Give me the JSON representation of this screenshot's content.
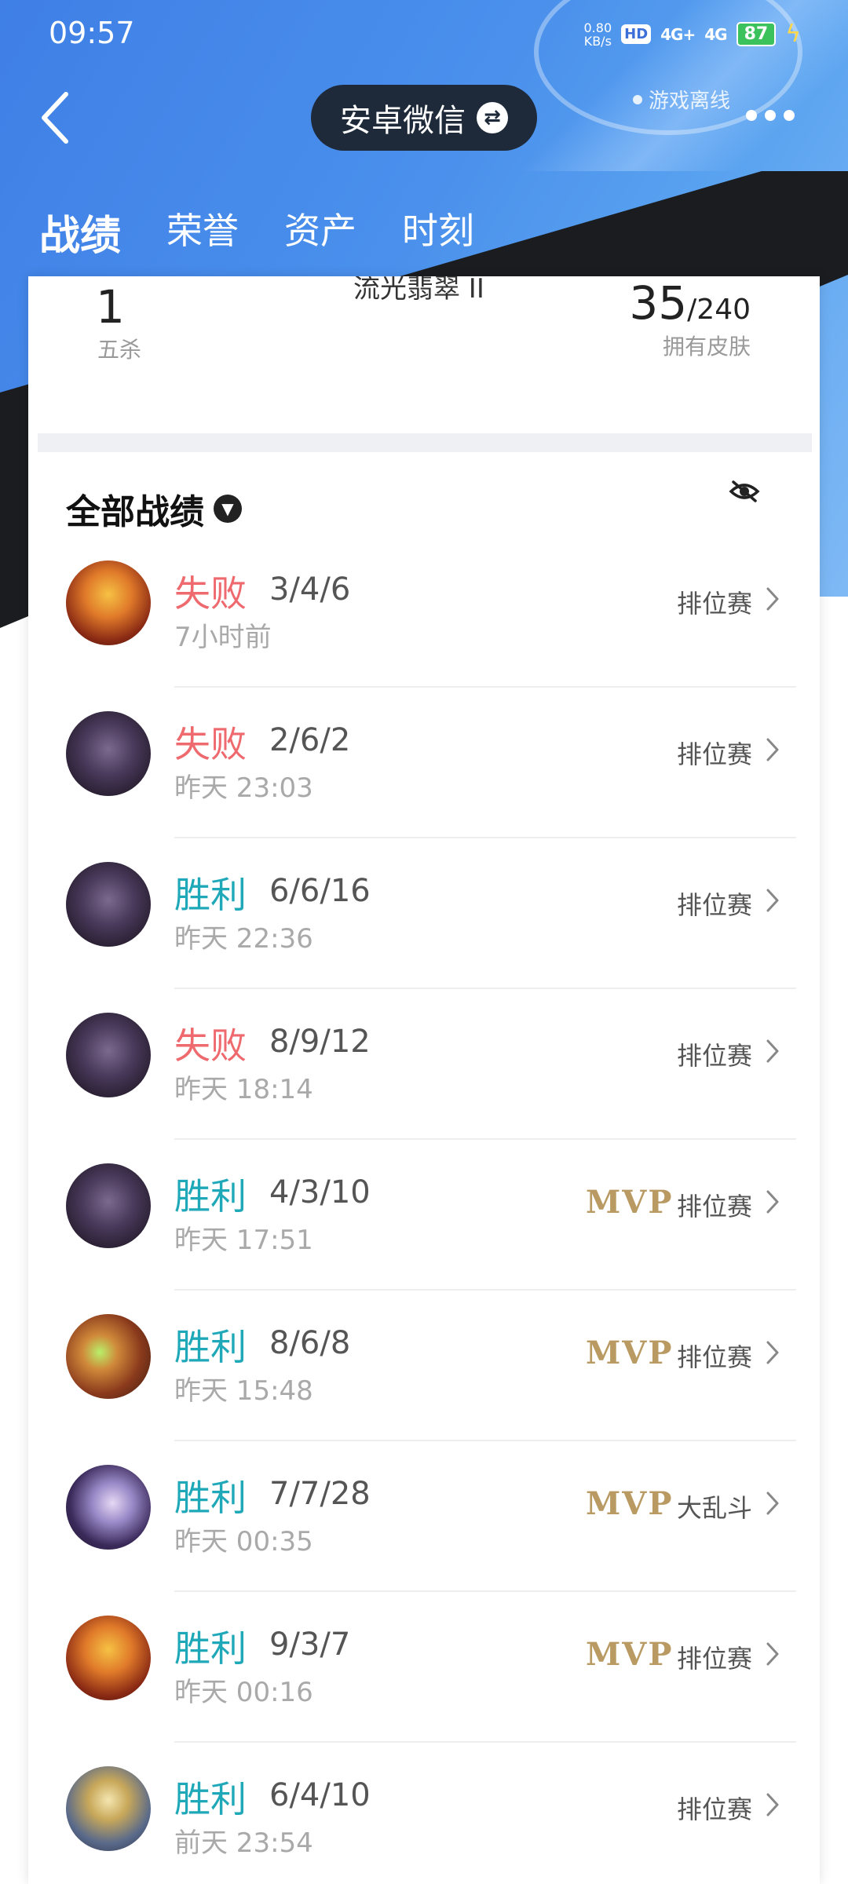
{
  "status_bar": {
    "time": "09:57",
    "net_speed_value": "0.80",
    "net_speed_unit": "KB/s",
    "hd": "HD",
    "signal_1": "4G+",
    "signal_2": "4G",
    "battery": "87"
  },
  "header": {
    "account_label": "安卓微信",
    "online_status": "游戏离线"
  },
  "tabs": [
    {
      "label": "战绩",
      "active": true
    },
    {
      "label": "荣誉",
      "active": false
    },
    {
      "label": "资产",
      "active": false
    },
    {
      "label": "时刻",
      "active": false
    }
  ],
  "stats": {
    "pentakill_count": "1",
    "pentakill_label": "五杀",
    "rank_title": "流光翡翠 II",
    "skins_owned": "35",
    "skins_total": "/240",
    "skins_label": "拥有皮肤"
  },
  "records": {
    "title": "全部战绩",
    "items": [
      {
        "result": "失败",
        "type": "loss",
        "kda": "3/4/6",
        "time": "7小时前",
        "mvp": "",
        "mode": "排位赛",
        "avatar": "fire"
      },
      {
        "result": "失败",
        "type": "loss",
        "kda": "2/6/2",
        "time": "昨天 23:03",
        "mvp": "",
        "mode": "排位赛",
        "avatar": "ape"
      },
      {
        "result": "胜利",
        "type": "win",
        "kda": "6/6/16",
        "time": "昨天 22:36",
        "mvp": "",
        "mode": "排位赛",
        "avatar": "ape"
      },
      {
        "result": "失败",
        "type": "loss",
        "kda": "8/9/12",
        "time": "昨天 18:14",
        "mvp": "",
        "mode": "排位赛",
        "avatar": "ape"
      },
      {
        "result": "胜利",
        "type": "win",
        "kda": "4/3/10",
        "time": "昨天 17:51",
        "mvp": "MVP",
        "mode": "排位赛",
        "avatar": "ape"
      },
      {
        "result": "胜利",
        "type": "win",
        "kda": "8/6/8",
        "time": "昨天 15:48",
        "mvp": "MVP",
        "mode": "排位赛",
        "avatar": "goggle"
      },
      {
        "result": "胜利",
        "type": "win",
        "kda": "7/7/28",
        "time": "昨天 00:35",
        "mvp": "MVP",
        "mode": "大乱斗",
        "avatar": "lady"
      },
      {
        "result": "胜利",
        "type": "win",
        "kda": "9/3/7",
        "time": "昨天 00:16",
        "mvp": "MVP",
        "mode": "排位赛",
        "avatar": "fire"
      },
      {
        "result": "胜利",
        "type": "win",
        "kda": "6/4/10",
        "time": "前天 23:54",
        "mvp": "",
        "mode": "排位赛",
        "avatar": "knight"
      }
    ]
  },
  "colors": {
    "loss": "#ee6a6e",
    "win": "#1fa8b8",
    "mvp": "#b99a62"
  }
}
